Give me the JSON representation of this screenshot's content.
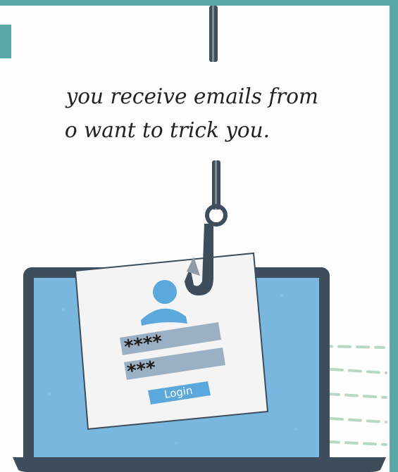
{
  "caption": {
    "line1": "you receive emails from",
    "line2": "o want to trick you."
  },
  "login_card": {
    "password_1": "****",
    "password_2": "***",
    "login_label": "Login"
  },
  "colors": {
    "background": "#5aa8a6",
    "screen": "#7ab7de",
    "laptop_frame": "#3d4d5c",
    "accent_blue": "#5ba9dc"
  },
  "icons": [
    "fishing-line-icon",
    "fishing-hook-icon",
    "user-avatar-icon",
    "laptop-icon"
  ]
}
